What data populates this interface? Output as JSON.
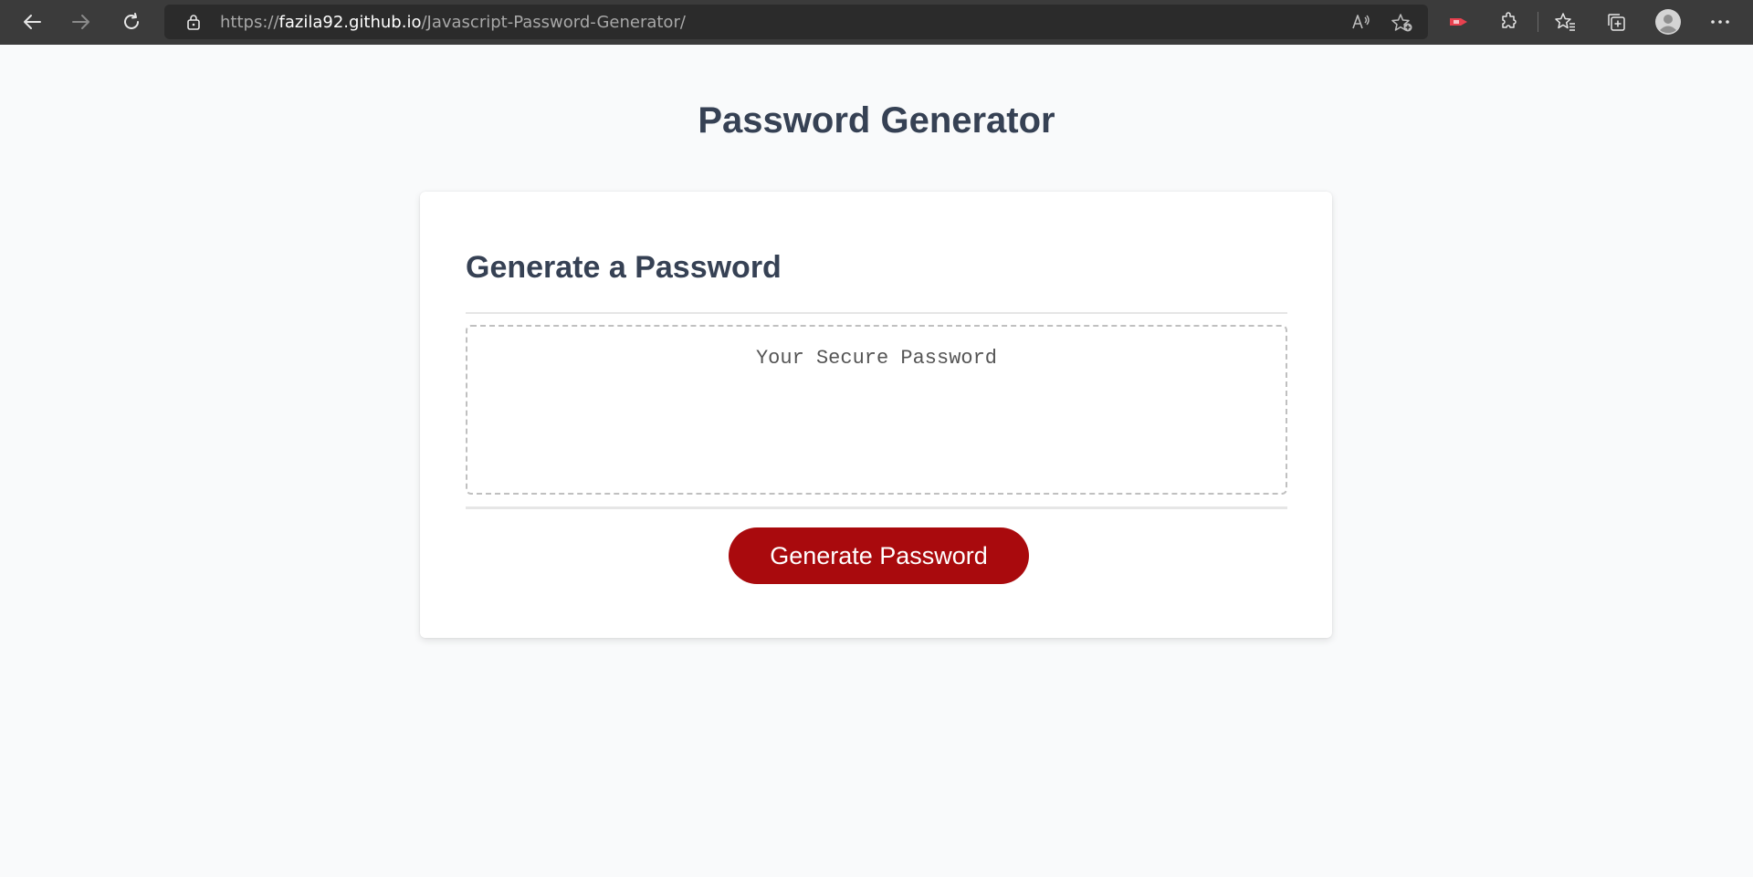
{
  "browser": {
    "url_scheme": "https://",
    "url_host": "fazila92.github.io",
    "url_path": "/Javascript-Password-Generator/",
    "icons": [
      "back-icon",
      "forward-icon",
      "refresh-icon",
      "lock-icon",
      "read-aloud-icon",
      "add-favorite-icon",
      "extension-red-icon",
      "extensions-icon",
      "favorites-icon",
      "collections-icon",
      "profile-avatar-icon",
      "more-icon"
    ]
  },
  "page": {
    "title": "Password Generator",
    "card_title": "Generate a Password",
    "password_placeholder": "Your Secure Password",
    "password_value": "",
    "generate_button": "Generate Password"
  },
  "colors": {
    "heading": "#364154",
    "button": "#a90a0d",
    "background": "#f9fafb"
  }
}
